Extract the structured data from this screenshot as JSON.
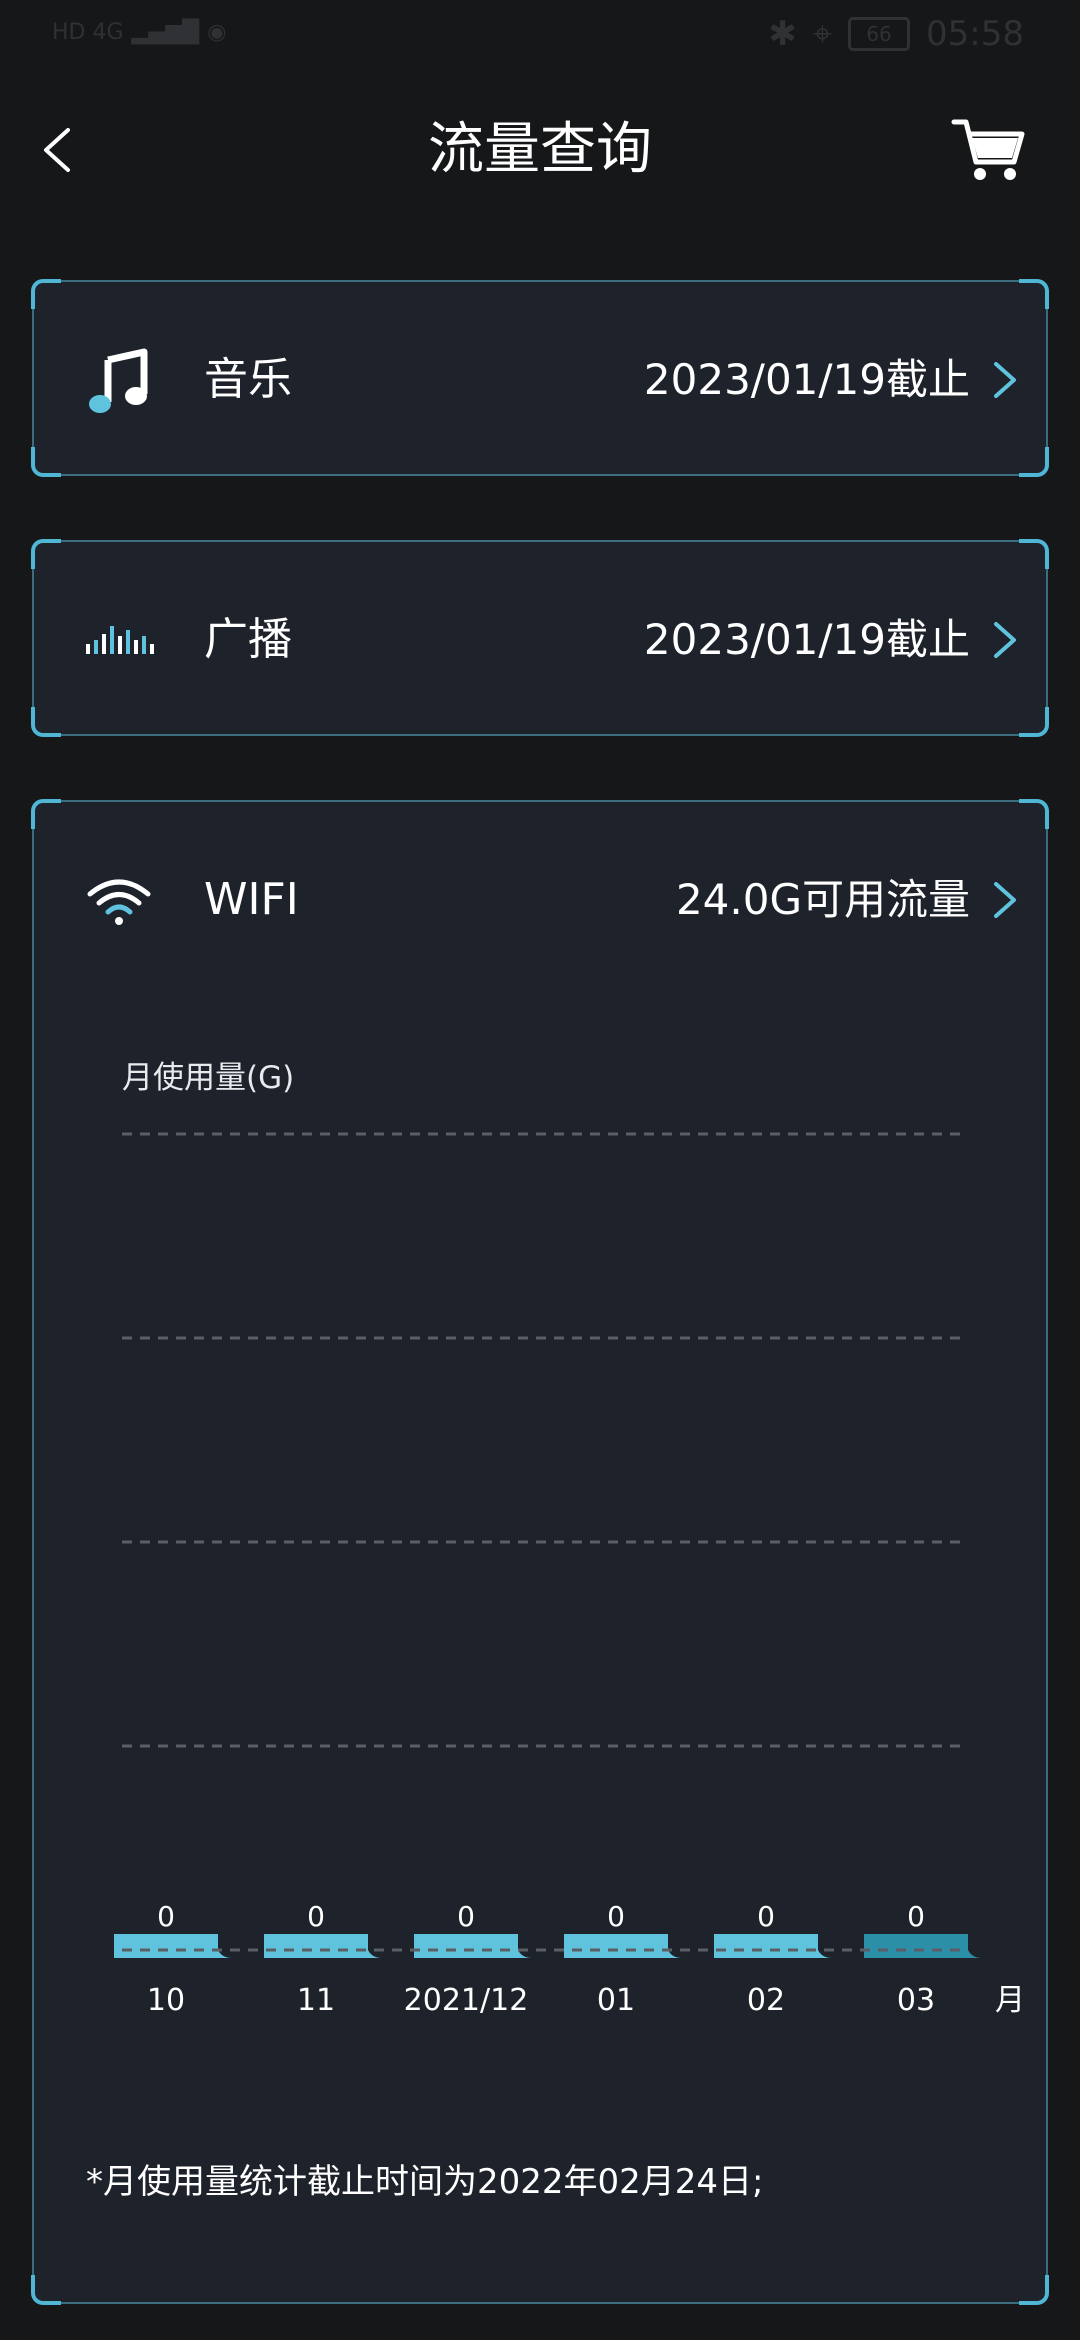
{
  "status_bar": {
    "left_text": "HD 4G",
    "time": "05:58",
    "battery": "66"
  },
  "header": {
    "title": "流量查询"
  },
  "cards": [
    {
      "label": "音乐",
      "value": "2023/01/19截止",
      "icon": "music-note-icon"
    },
    {
      "label": "广播",
      "value": "2023/01/19截止",
      "icon": "audio-wave-icon"
    },
    {
      "label": "WIFI",
      "value": "24.0G可用流量",
      "icon": "wifi-icon"
    }
  ],
  "chart_data": {
    "type": "bar",
    "ylabel": "月使用量(G)",
    "xlabel": "月",
    "categories": [
      "10",
      "11",
      "2021/12",
      "01",
      "02",
      "03"
    ],
    "values": [
      0,
      0,
      0,
      0,
      0,
      0
    ],
    "data_labels": [
      "0",
      "0",
      "0",
      "0",
      "0",
      "0"
    ],
    "grid": true,
    "colors": {
      "bar": "#5fc3dd",
      "bar_last": "#2c8fa8",
      "grid": "#5a5f66"
    }
  },
  "footnote": "*月使用量统计截止时间为2022年02月24日;"
}
